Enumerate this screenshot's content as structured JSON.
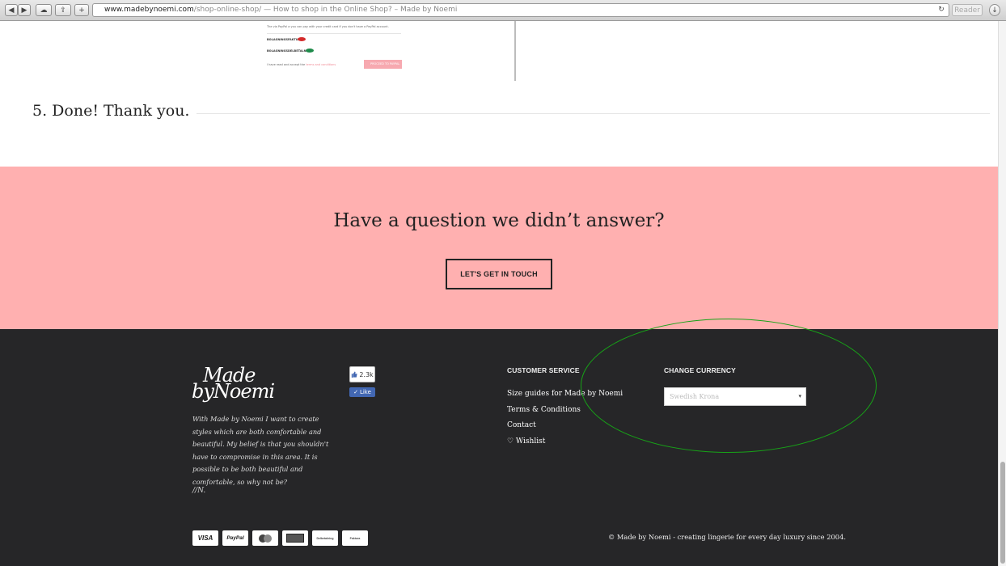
{
  "browser": {
    "url_domain": "www.madebynoemi.com",
    "url_path": "/shop-online-shop/",
    "page_title": " — How to shop in the Online Shop? – Made by Noemi",
    "reader_label": "Reader"
  },
  "embedded_screenshot": {
    "intro_text": "The via PayPal a you can pay with your credit card if you don't have a PayPal account.",
    "option_invoice": "BOLAGNINGSFAKTURA",
    "option_partpay": "BOLAGNINGSDELBETALNING",
    "terms_text": "I have read and accept the",
    "terms_link": "terms and conditions",
    "button": "PROCEED TO PAYPAL"
  },
  "step": {
    "label": "5. Done! Thank you."
  },
  "cta": {
    "question": "Have a question we didn’t answer?",
    "button": "LET'S GET IN TOUCH"
  },
  "footer": {
    "brand_line1": "Made",
    "brand_line2": "byNoemi",
    "about": "With Made by Noemi I want to create styles which are both comfortable and beautiful. My belief is that you shouldn't have to compromise in this area. It is possible to be both beautiful and comfortable, so why not be?",
    "signature": "//N.",
    "facebook": {
      "count": "2.3k",
      "like_label": "Like"
    },
    "customer_service": {
      "heading": "CUSTOMER SERVICE",
      "links": [
        "Size guides for Made by Noemi",
        "Terms & Conditions",
        "Contact",
        "♡ Wishlist"
      ]
    },
    "currency": {
      "heading": "CHANGE CURRENCY",
      "selected": "Swedish Krona"
    },
    "payments": [
      "VISA",
      "PayPal",
      "MasterCard",
      "Faktura",
      "Delbetalning",
      "Faktura"
    ],
    "copyright": "© Made by Noemi - creating lingerie for every day luxury since 2004."
  },
  "colors": {
    "pink_band": "#ffb0b0",
    "footer_bg": "#262628",
    "highlight_ellipse": "#17a317",
    "facebook_blue": "#4267b2"
  }
}
